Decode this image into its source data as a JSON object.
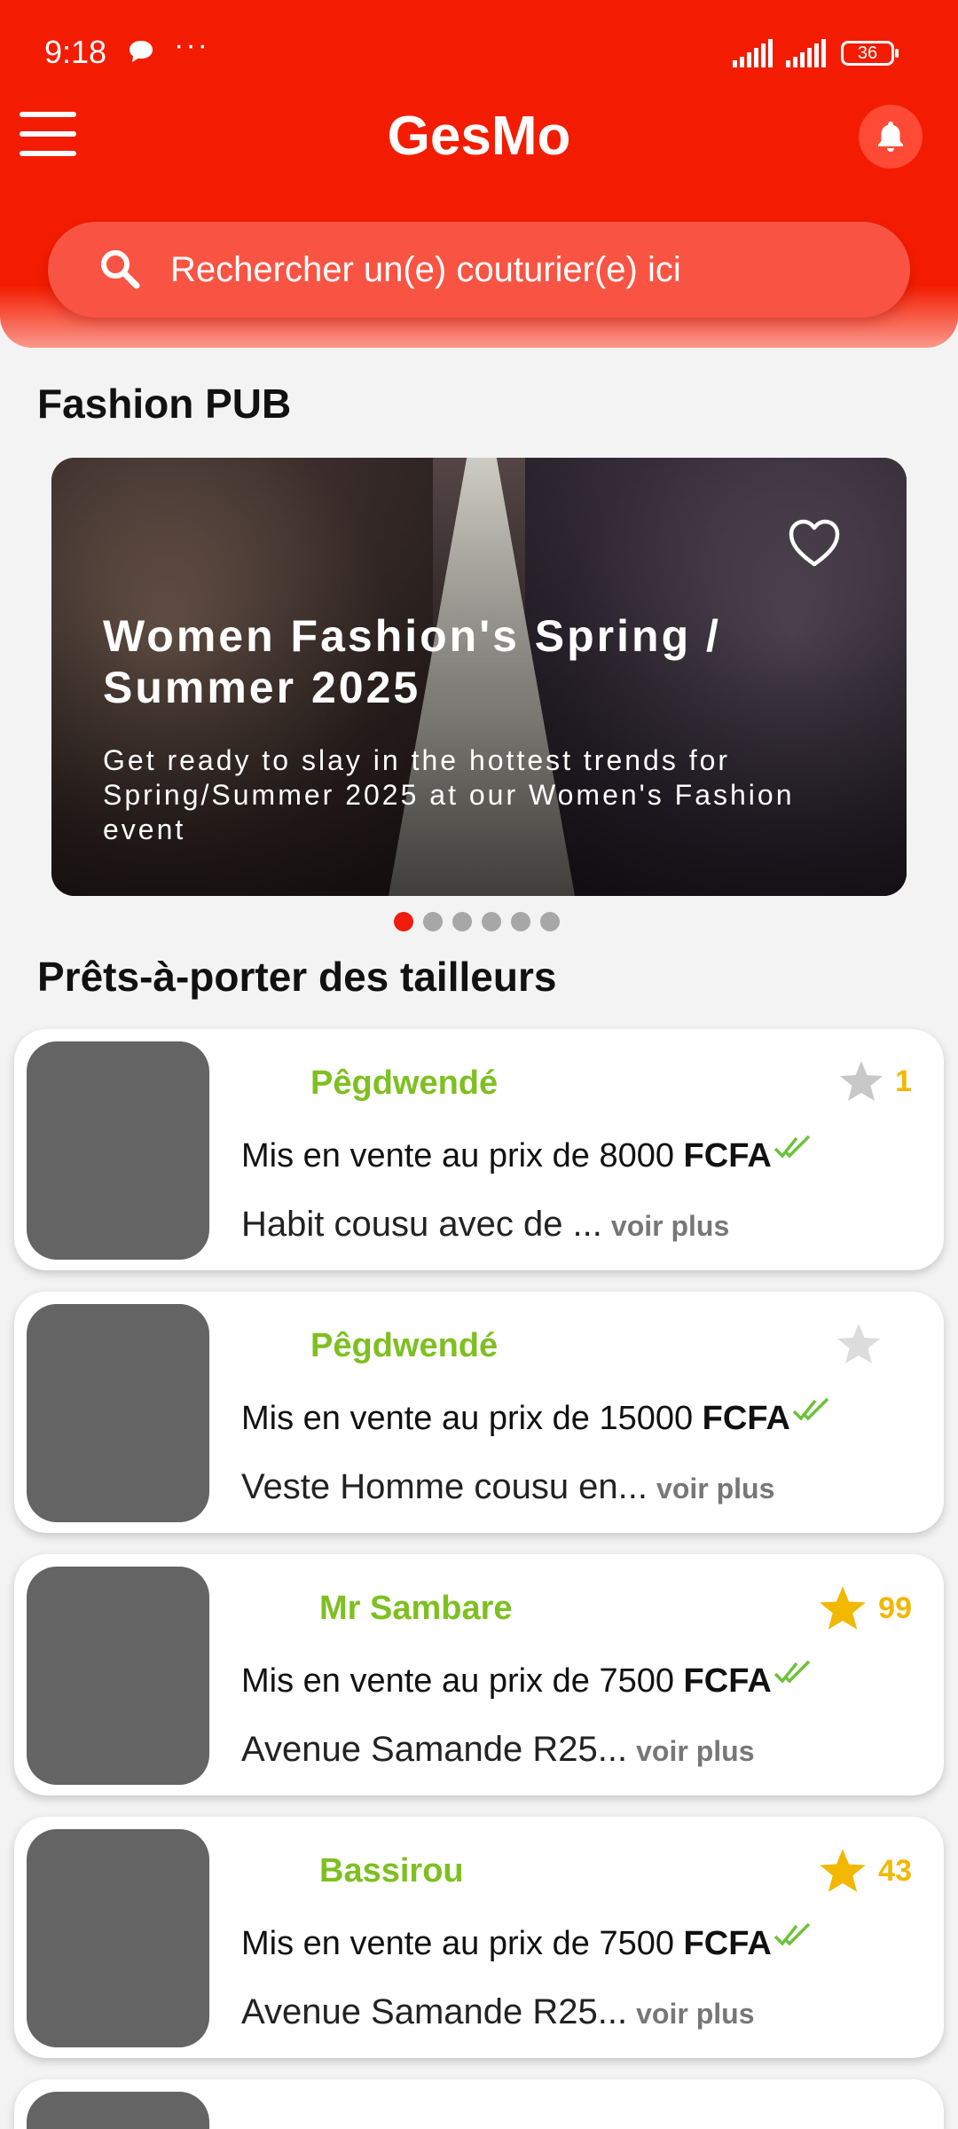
{
  "status_bar": {
    "time": "9:18",
    "dots": "···",
    "battery": "36"
  },
  "header": {
    "title": "GesMo"
  },
  "search": {
    "placeholder": "Rechercher un(e) couturier(e) ici"
  },
  "sections": {
    "fashion_pub": "Fashion PUB",
    "pret_a_porter": "Prêts-à-porter des tailleurs"
  },
  "banner": {
    "title": "Women Fashion's Spring / Summer 2025",
    "description": "Get ready to slay in the hottest trends for Spring/Summer 2025 at our Women's Fashion event",
    "slides_count": 6,
    "active_slide": 0
  },
  "listings": [
    {
      "seller": "Pêgdwendé",
      "rating": "1",
      "star": "grey",
      "price_prefix": "Mis en vente au prix de ",
      "price": "8000",
      "currency": "FCFA",
      "desc": "Habit cousu avec de ...",
      "more": "voir plus"
    },
    {
      "seller": "Pêgdwendé",
      "rating": "",
      "star": "grey",
      "price_prefix": "Mis en vente au prix de ",
      "price": "15000",
      "currency": "FCFA",
      "desc": "Veste Homme cousu en...",
      "more": "voir plus"
    },
    {
      "seller": "Mr Sambare",
      "rating": "99",
      "star": "gold",
      "price_prefix": "Mis en vente au prix de ",
      "price": " 7500",
      "currency": "FCFA",
      "desc": "Avenue Samande R25...",
      "more": "voir plus"
    },
    {
      "seller": "Bassirou",
      "rating": "43",
      "star": "gold",
      "price_prefix": "Mis en vente au prix de ",
      "price": " 7500",
      "currency": "FCFA",
      "desc": "Avenue Samande R25...",
      "more": "voir plus"
    }
  ],
  "colors": {
    "primary": "#f41c00",
    "seller_green": "#7ec020",
    "star_gold": "#f2b800",
    "star_grey": "#c8c8c8"
  }
}
